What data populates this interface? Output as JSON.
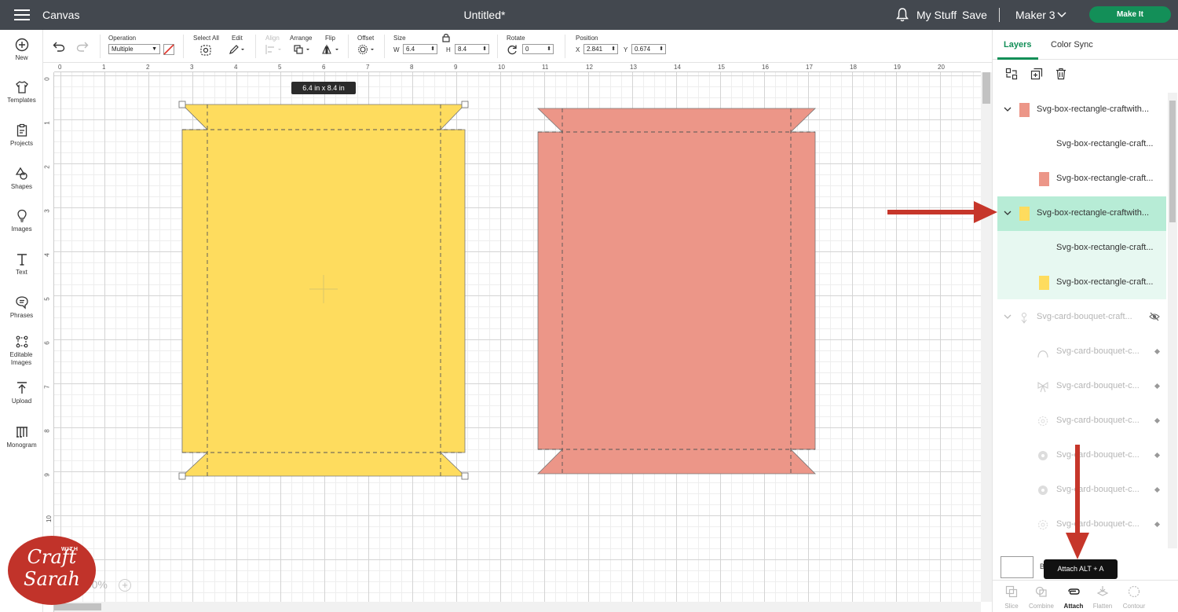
{
  "header": {
    "app_name": "Canvas",
    "doc_title": "Untitled*",
    "my_stuff": "My Stuff",
    "save": "Save",
    "machine": "Maker 3",
    "make_it": "Make It"
  },
  "sidebar": {
    "items": [
      {
        "label": "New",
        "icon": "plus-circle-icon"
      },
      {
        "label": "Templates",
        "icon": "shirt-icon"
      },
      {
        "label": "Projects",
        "icon": "clipboard-icon"
      },
      {
        "label": "Shapes",
        "icon": "shapes-icon"
      },
      {
        "label": "Images",
        "icon": "lightbulb-icon"
      },
      {
        "label": "Text",
        "icon": "text-icon"
      },
      {
        "label": "Phrases",
        "icon": "speech-bubble-icon"
      },
      {
        "label": "Editable Images",
        "icon": "editable-image-icon"
      },
      {
        "label": "Upload",
        "icon": "upload-icon"
      },
      {
        "label": "Monogram",
        "icon": "monogram-icon"
      }
    ]
  },
  "toolbar": {
    "operation_label": "Operation",
    "operation_value": "Multiple",
    "select_all": "Select All",
    "edit": "Edit",
    "align": "Align",
    "arrange": "Arrange",
    "flip": "Flip",
    "offset": "Offset",
    "size_label": "Size",
    "w_label": "W",
    "w_value": "6.4",
    "h_label": "H",
    "h_value": "8.4",
    "rotate_label": "Rotate",
    "rotate_value": "0",
    "position_label": "Position",
    "x_label": "X",
    "x_value": "2.841",
    "y_label": "Y",
    "y_value": "0.674"
  },
  "canvas": {
    "size_tooltip": "6.4  in x 8.4  in",
    "zoom": "100%",
    "zoom_plus": "+",
    "ruler_top": [
      "0",
      "1",
      "2",
      "3",
      "4",
      "5",
      "6",
      "7",
      "8",
      "9",
      "10",
      "11",
      "12",
      "13",
      "14",
      "15",
      "16",
      "17",
      "18",
      "19",
      "20"
    ],
    "ruler_left": [
      "0",
      "1",
      "2",
      "3",
      "4",
      "5",
      "6",
      "7",
      "8",
      "9",
      "10"
    ],
    "colors": {
      "yellow": "#fedc5e",
      "salmon": "#ec9688"
    }
  },
  "right_panel": {
    "tabs": [
      "Layers",
      "Color Sync"
    ],
    "layers": [
      {
        "name": "Svg-box-rectangle-craftwith...",
        "type": "group",
        "swatch": "#ec9688",
        "hidden": false
      },
      {
        "name": "Svg-box-rectangle-craft...",
        "type": "child",
        "swatch": null
      },
      {
        "name": "Svg-box-rectangle-craft...",
        "type": "child",
        "swatch": "#ec9688"
      },
      {
        "name": "Svg-box-rectangle-craftwith...",
        "type": "group",
        "swatch": "#fedc5e",
        "selected": true
      },
      {
        "name": "Svg-box-rectangle-craft...",
        "type": "child",
        "swatch": null
      },
      {
        "name": "Svg-box-rectangle-craft...",
        "type": "child",
        "swatch": "#fedc5e"
      },
      {
        "name": "Svg-card-bouquet-craft...",
        "type": "group",
        "hidden": true
      },
      {
        "name": "Svg-card-bouquet-c...",
        "type": "child",
        "icon": "arch-icon"
      },
      {
        "name": "Svg-card-bouquet-c...",
        "type": "child",
        "icon": "bow-icon"
      },
      {
        "name": "Svg-card-bouquet-c...",
        "type": "child",
        "icon": "flower-outline-icon"
      },
      {
        "name": "Svg-card-bouquet-c...",
        "type": "child",
        "icon": "flower-filled-icon"
      },
      {
        "name": "Svg-card-bouquet-c...",
        "type": "child",
        "icon": "flower-filled-icon"
      },
      {
        "name": "Svg-card-bouquet-c...",
        "type": "child",
        "icon": "flower-outline-icon"
      }
    ],
    "attach_tooltip": "Attach ALT + A",
    "blank_label": "B",
    "bottom_tools": [
      "Slice",
      "Combine",
      "Attach",
      "Flatten",
      "Contour"
    ]
  },
  "watermark": {
    "line1": "Craft",
    "with": "WITH",
    "line2": "Sarah"
  }
}
